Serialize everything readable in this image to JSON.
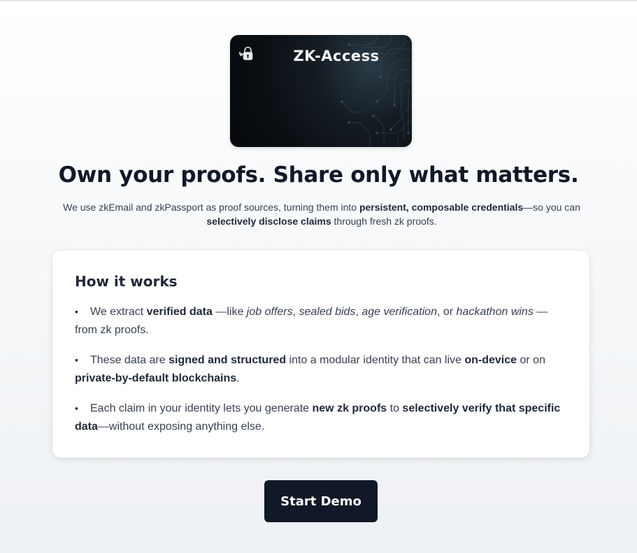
{
  "card": {
    "title": "ZK-Access",
    "icon": "lock-key-icon"
  },
  "hero": {
    "headline": "Own your proofs. Share only what matters.",
    "subtitle": {
      "part1": "We use zkEmail and zkPassport as proof sources, turning them into ",
      "bold1": "persistent, composable credentials",
      "part2": "—so you can ",
      "bold2": "selectively disclose claims",
      "part3": " through fresh zk proofs."
    }
  },
  "how_it_works": {
    "title": "How it works",
    "items": [
      {
        "t1": "We extract ",
        "b1": "verified data",
        "t2": " —like ",
        "i1": "job offers",
        "t3": ", ",
        "i2": "sealed bids",
        "t4": ", ",
        "i3": "age verification",
        "t5": ", or ",
        "i4": "hackathon wins",
        "t6": " — from zk proofs."
      },
      {
        "t1": "These data are ",
        "b1": "signed and structured",
        "t2": " into a modular identity that can live ",
        "b2": "on-device",
        "t3": " or on ",
        "b3": "private-by-default blockchains",
        "t4": "."
      },
      {
        "t1": "Each claim in your identity lets you generate ",
        "b1": "new zk proofs",
        "t2": " to ",
        "b2": "selectively verify that specific data",
        "t3": "—without exposing anything else."
      }
    ]
  },
  "actions": {
    "start_label": "Start Demo"
  },
  "colors": {
    "primary_button": "#111827",
    "card_background": "#0a0e12",
    "panel_background": "#ffffff"
  }
}
